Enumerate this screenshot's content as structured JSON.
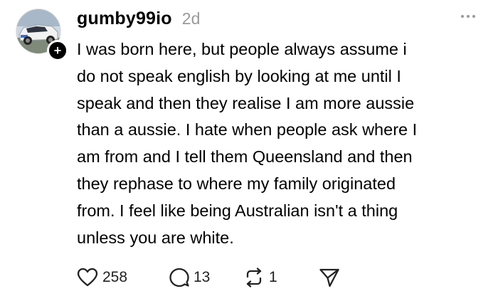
{
  "post": {
    "username": "gumby99io",
    "timestamp": "2d",
    "text_lines": [
      "I was born here, but people always assume i",
      "do not speak english by looking at me until I",
      "speak and then they realise I am more aussie",
      "than a aussie. I hate when people ask where I",
      "am from and I tell them Queensland and then",
      "they rephase to where my family originated",
      "from. I feel like being Australian isn't a thing",
      "unless you are white."
    ],
    "avatar_icon": "car-photo-avatar",
    "follow_badge": "+",
    "actions": {
      "like_count": "258",
      "comment_count": "13",
      "repost_count": "1"
    }
  },
  "colors": {
    "background": "#ffffff",
    "text": "#000000",
    "muted": "#9a9a9a"
  }
}
